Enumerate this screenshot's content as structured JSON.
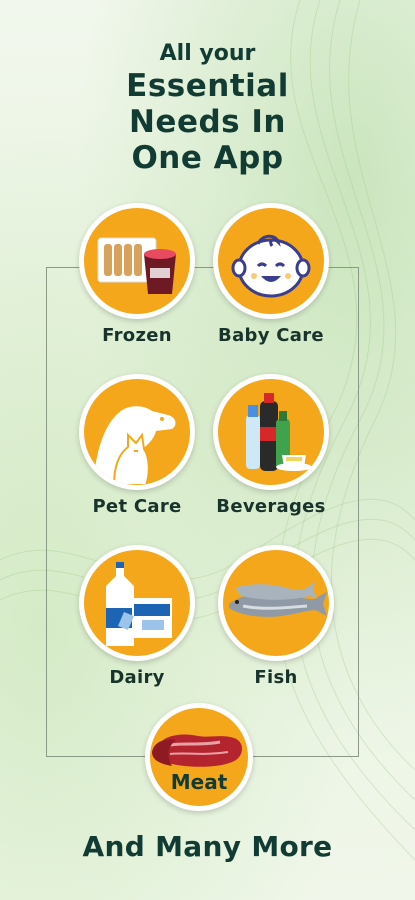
{
  "headline": {
    "line1": "All your",
    "line2": "Essential",
    "line3": "Needs In",
    "line4": "One App"
  },
  "categories": [
    {
      "label": "Frozen",
      "icon": "frozen-food-icon"
    },
    {
      "label": "Baby Care",
      "icon": "baby-face-icon"
    },
    {
      "label": "Pet Care",
      "icon": "dog-cat-icon"
    },
    {
      "label": "Beverages",
      "icon": "beverage-bottles-icon"
    },
    {
      "label": "Dairy",
      "icon": "milk-bottle-icon"
    },
    {
      "label": "Fish",
      "icon": "fish-icon"
    }
  ],
  "featured": {
    "label": "Meat",
    "icon": "meat-steak-icon"
  },
  "footer": "And Many More",
  "colors": {
    "accent": "#f4a71b",
    "text": "#123b34",
    "background": "#eef5e6"
  }
}
